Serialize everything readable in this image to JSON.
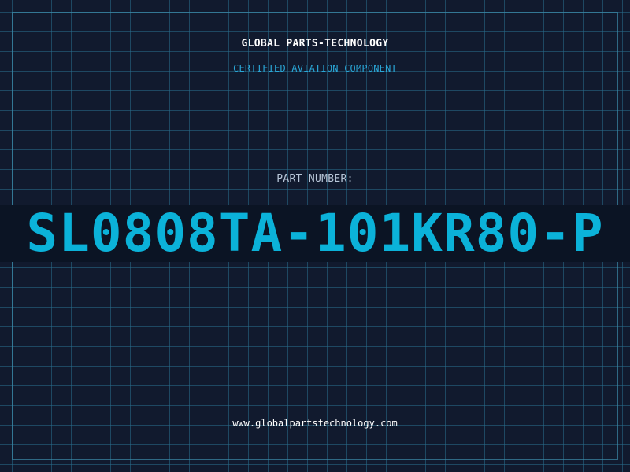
{
  "header": {
    "company": "GLOBAL PARTS-TECHNOLOGY",
    "tagline": "CERTIFIED AVIATION COMPONENT"
  },
  "part": {
    "label": "PART NUMBER:",
    "number": "SL0808TA-101KR80-P"
  },
  "footer": {
    "website": "www.globalpartstechnology.com"
  },
  "colors": {
    "background": "#111a2e",
    "grid": "#286e8c",
    "accent": "#0bb2d9",
    "tagline": "#2aa6d6",
    "band": "#0b1424"
  }
}
